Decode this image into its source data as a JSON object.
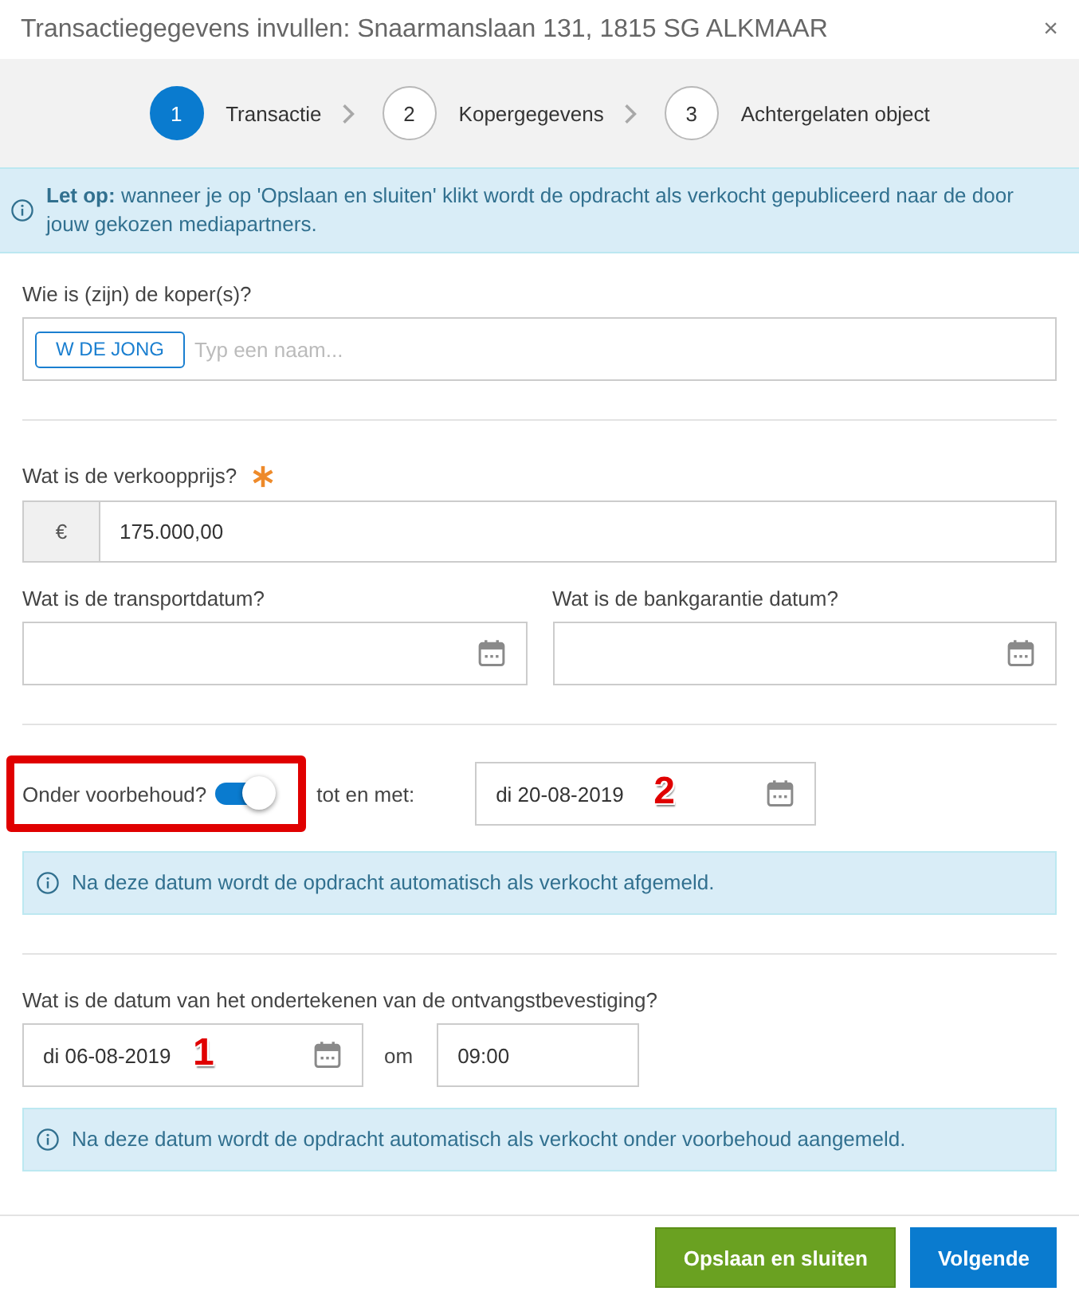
{
  "window": {
    "title": "Transactiegegevens invullen: Snaarmanslaan 131, 1815 SG ALKMAAR",
    "close": "×"
  },
  "steps": [
    {
      "number": "1",
      "label": "Transactie",
      "selected": true
    },
    {
      "number": "2",
      "label": "Kopergegevens",
      "selected": false
    },
    {
      "number": "3",
      "label": "Achtergelaten object",
      "selected": false
    }
  ],
  "notice": {
    "text": "**Let op:** wanneer je op 'Opslaan en sluiten' klikt wordt de opdracht als verkocht gepubliceerd naar de door jouw gekozen mediapartners."
  },
  "buyers": {
    "label": "Wie is (zijn) de koper(s)?",
    "tags": [
      "W DE JONG"
    ],
    "placeholder": "Typ een naam..."
  },
  "price": {
    "label": "Wat is de verkoopprijs?",
    "required": true,
    "currency": "€",
    "value": "175.000,00"
  },
  "dates": [
    {
      "label": "Wat is de transportdatum?"
    },
    {
      "label": "Wat is de bankgarantie datum?"
    }
  ],
  "reservation": {
    "label": "Onder voorbehoud?",
    "on": true,
    "highlighted": true,
    "until_label": "tot en met:",
    "until_value": "di 20-08-2019",
    "annotation": "2",
    "notice": "Na deze datum wordt de opdracht automatisch als verkocht afgemeld."
  },
  "signing": {
    "label": "Wat is de datum van het ondertekenen van de ontvangstbevestiging?",
    "date": "di 06-08-2019",
    "annotation": "1",
    "at_label": "om",
    "time": "09:00",
    "notice": "Na deze datum wordt de opdracht automatisch als verkocht onder voorbehoud aangemeld."
  },
  "buttons": [
    {
      "label": "Opslaan en sluiten",
      "kind": "success"
    },
    {
      "label": "Volgende",
      "kind": "primary"
    }
  ]
}
